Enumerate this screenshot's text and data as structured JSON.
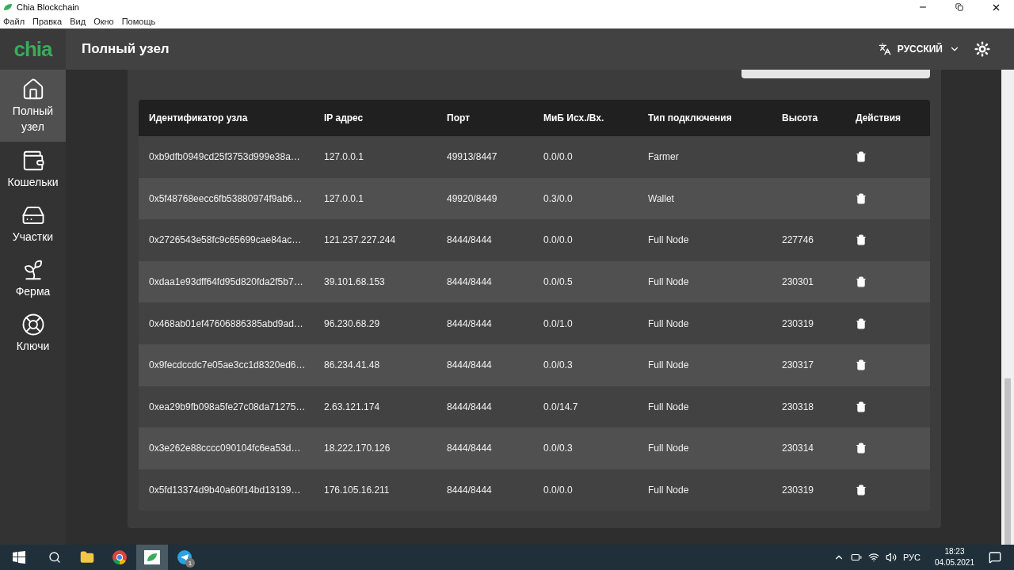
{
  "window": {
    "title": "Chia Blockchain"
  },
  "menu": [
    "Файл",
    "Правка",
    "Вид",
    "Окно",
    "Помощь"
  ],
  "header": {
    "logo": "chia",
    "title": "Полный узел",
    "language": "РУССКИЙ"
  },
  "sidebar": {
    "items": [
      {
        "label": "Полный узел",
        "kind": "home",
        "selected": true
      },
      {
        "label": "Кошельки",
        "kind": "wallet",
        "selected": false
      },
      {
        "label": "Участки",
        "kind": "drive",
        "selected": false
      },
      {
        "label": "Ферма",
        "kind": "plant",
        "selected": false
      },
      {
        "label": "Ключи",
        "kind": "lifebuoy",
        "selected": false
      }
    ]
  },
  "table": {
    "columns": [
      "Идентификатор узла",
      "IP адрес",
      "Порт",
      "МиБ Исх./Вх.",
      "Тип подключения",
      "Высота",
      "Действия"
    ],
    "rows": [
      [
        "0xb9dfb0949cd25f3753d999e38a…",
        "127.0.0.1",
        "49913/8447",
        "0.0/0.0",
        "Farmer",
        ""
      ],
      [
        "0x5f48768eecc6fb53880974f9ab6…",
        "127.0.0.1",
        "49920/8449",
        "0.3/0.0",
        "Wallet",
        ""
      ],
      [
        "0x2726543e58fc9c65699cae84ac…",
        "121.237.227.244",
        "8444/8444",
        "0.0/0.0",
        "Full Node",
        "227746"
      ],
      [
        "0xdaa1e93dff64fd95d820fda2f5b7…",
        "39.101.68.153",
        "8444/8444",
        "0.0/0.5",
        "Full Node",
        "230301"
      ],
      [
        "0x468ab01ef47606886385abd9ad…",
        "96.230.68.29",
        "8444/8444",
        "0.0/1.0",
        "Full Node",
        "230319"
      ],
      [
        "0x9fecdccdc7e05ae3cc1d8320ed6…",
        "86.234.41.48",
        "8444/8444",
        "0.0/0.3",
        "Full Node",
        "230317"
      ],
      [
        "0xea29b9fb098a5fe27c08da71275…",
        "2.63.121.174",
        "8444/8444",
        "0.0/14.7",
        "Full Node",
        "230318"
      ],
      [
        "0x3e262e88cccc090104fc6ea53d…",
        "18.222.170.126",
        "8444/8444",
        "0.0/0.3",
        "Full Node",
        "230314"
      ],
      [
        "0x5fd13374d9b40a60f14bd13139…",
        "176.105.16.211",
        "8444/8444",
        "0.0/0.0",
        "Full Node",
        "230319"
      ]
    ]
  },
  "taskbar": {
    "language": "РУС",
    "time": "18:23",
    "date": "04.05.2021",
    "badge": "1"
  }
}
